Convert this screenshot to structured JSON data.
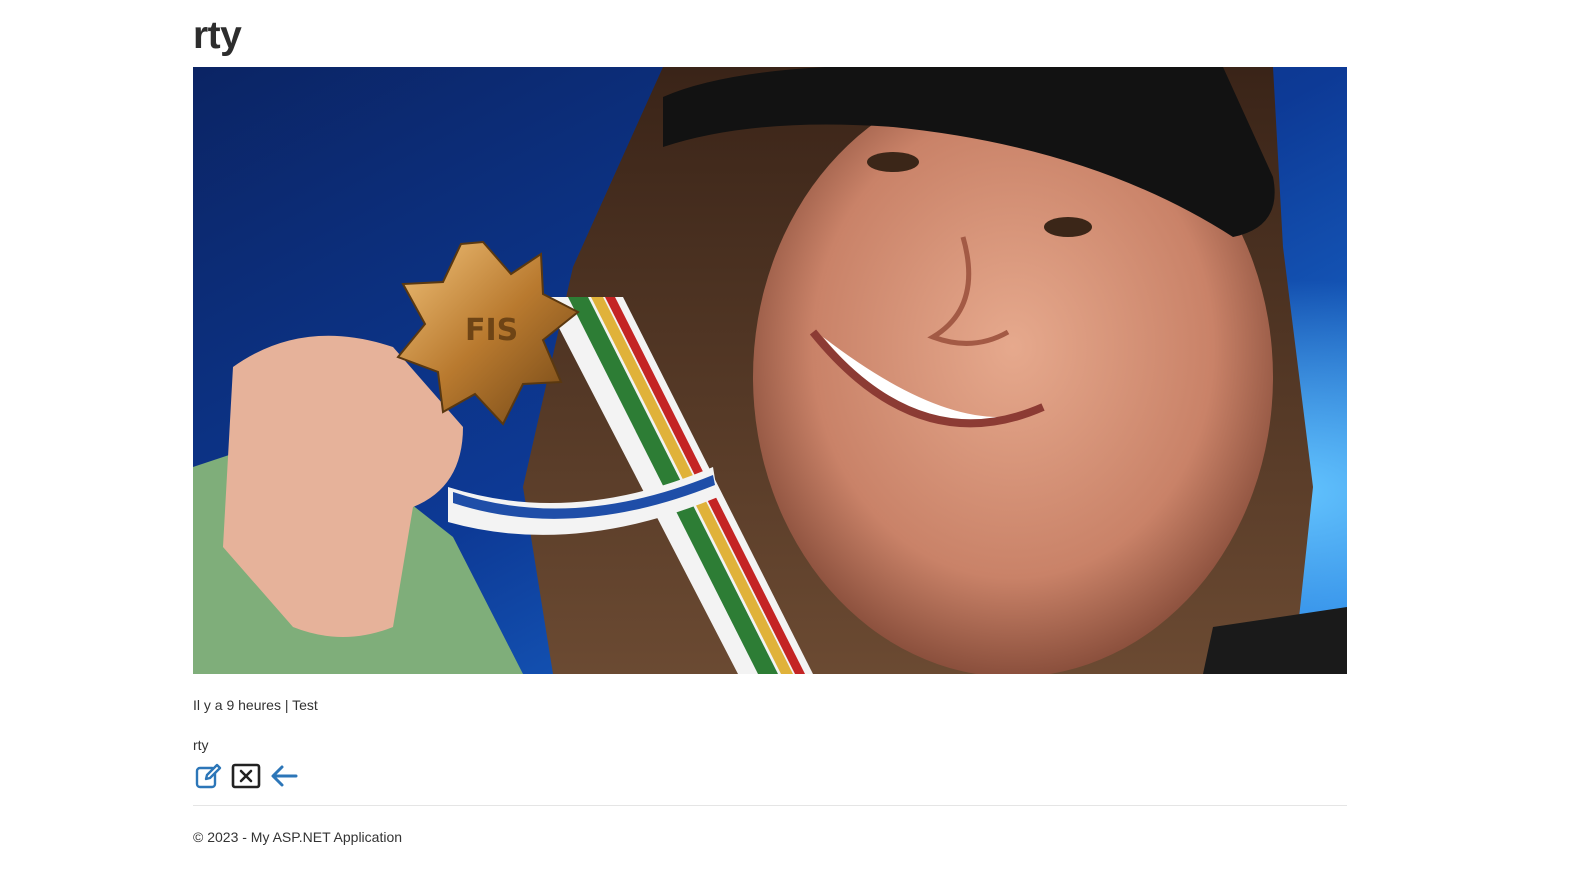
{
  "article": {
    "title": "rty",
    "meta": "Il y a 9 heures | Test",
    "body": "rty",
    "image": {
      "subject": "athlete-with-medal-photo"
    }
  },
  "actions": {
    "edit_icon": "edit-icon",
    "delete_icon": "delete-box-icon",
    "back_icon": "arrow-left-icon"
  },
  "footer": {
    "text": "© 2023 - My ASP.NET Application"
  },
  "colors": {
    "link": "#2c76b8",
    "text": "#333333",
    "icon_dark": "#222222"
  }
}
